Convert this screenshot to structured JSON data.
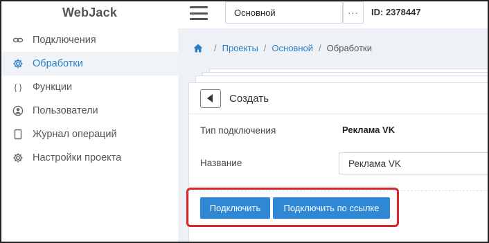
{
  "app": {
    "logo": "WebJack"
  },
  "sidebar": {
    "items": [
      {
        "label": "Подключения",
        "icon": "link-icon",
        "active": false
      },
      {
        "label": "Обработки",
        "icon": "gear-icon",
        "active": true
      },
      {
        "label": "Функции",
        "icon": "braces-icon",
        "active": false
      },
      {
        "label": "Пользователи",
        "icon": "user-icon",
        "active": false
      },
      {
        "label": "Журнал операций",
        "icon": "document-icon",
        "active": false
      },
      {
        "label": "Настройки проекта",
        "icon": "gear-icon",
        "active": false
      }
    ]
  },
  "topbar": {
    "project_select_value": "Основной",
    "more_label": "···",
    "project_id": "ID: 2378447"
  },
  "breadcrumb": {
    "home_icon": "home-icon",
    "items": [
      "Проекты",
      "Основной",
      "Обработки"
    ],
    "separator": "/"
  },
  "form": {
    "title": "Создать",
    "connection_type_label": "Тип подключения",
    "connection_type_value": "Реклама VK",
    "name_label": "Название",
    "name_value": "Реклама VK",
    "connect_button": "Подключить",
    "connect_link_button": "Подключить по ссылке"
  },
  "colors": {
    "accent": "#2a7fc9",
    "button": "#2f88d6",
    "highlight": "#d9262c",
    "content_bg": "#eef1f5"
  }
}
